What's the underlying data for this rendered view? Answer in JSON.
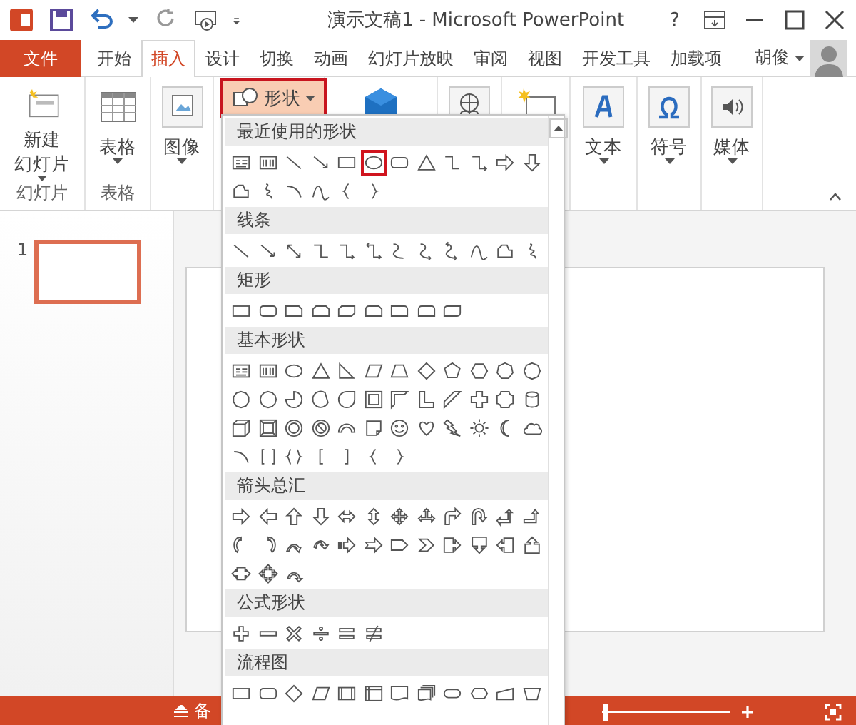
{
  "title_bar": {
    "title": "演示文稿1 - Microsoft PowerPoint",
    "help": "?"
  },
  "tabs": [
    {
      "label": "文件",
      "kind": "file",
      "selected": false
    },
    {
      "label": "开始",
      "kind": "tab",
      "selected": false
    },
    {
      "label": "插入",
      "kind": "tab",
      "selected": true
    },
    {
      "label": "设计",
      "kind": "tab",
      "selected": false
    },
    {
      "label": "切换",
      "kind": "tab",
      "selected": false
    },
    {
      "label": "动画",
      "kind": "tab",
      "selected": false
    },
    {
      "label": "幻灯片放映",
      "kind": "tab",
      "selected": false
    },
    {
      "label": "审阅",
      "kind": "tab",
      "selected": false
    },
    {
      "label": "视图",
      "kind": "tab",
      "selected": false
    },
    {
      "label": "开发工具",
      "kind": "tab",
      "selected": false
    },
    {
      "label": "加载项",
      "kind": "tab",
      "selected": false
    }
  ],
  "account": {
    "name": "胡俊"
  },
  "ribbon": [
    {
      "kind": "new-slide",
      "lines": [
        "新建",
        "幻灯片"
      ],
      "group": "幻灯片"
    },
    {
      "kind": "table",
      "label": "表格",
      "group": "表格"
    },
    {
      "kind": "image",
      "label": "图像"
    },
    {
      "kind": "shapes",
      "label": "形状",
      "expanded": true
    },
    {
      "kind": "smartart"
    },
    {
      "kind": "link"
    },
    {
      "kind": "comment"
    },
    {
      "kind": "text",
      "label": "文本"
    },
    {
      "kind": "symbol",
      "label": "符号"
    },
    {
      "kind": "media",
      "label": "媒体"
    }
  ],
  "shapes_menu": [
    {
      "title": "最近使用的形状",
      "items": [
        {
          "kind": "text-box",
          "selected": false
        },
        {
          "kind": "vertical-text-box",
          "selected": false
        },
        {
          "kind": "line",
          "selected": false
        },
        {
          "kind": "arrow-line",
          "selected": false
        },
        {
          "kind": "rectangle",
          "selected": false
        },
        {
          "kind": "ellipse",
          "selected": true
        },
        {
          "kind": "rounded-rectangle",
          "selected": false
        },
        {
          "kind": "triangle",
          "selected": false
        },
        {
          "kind": "elbow-connector",
          "selected": false
        },
        {
          "kind": "elbow-arrow",
          "selected": false
        },
        {
          "kind": "right-arrow",
          "selected": false
        },
        {
          "kind": "down-arrow",
          "selected": false
        },
        {
          "kind": "freeform",
          "selected": false
        },
        {
          "kind": "scribble",
          "selected": false
        },
        {
          "kind": "arc",
          "selected": false
        },
        {
          "kind": "curve",
          "selected": false
        },
        {
          "kind": "left-brace",
          "selected": false
        },
        {
          "kind": "right-brace",
          "selected": false
        }
      ]
    },
    {
      "title": "线条",
      "items": [
        {
          "kind": "line",
          "selected": false
        },
        {
          "kind": "arrow-line",
          "selected": false
        },
        {
          "kind": "double-arrow-line",
          "selected": false
        },
        {
          "kind": "elbow-connector",
          "selected": false
        },
        {
          "kind": "elbow-arrow",
          "selected": false
        },
        {
          "kind": "elbow-double-arrow",
          "selected": false
        },
        {
          "kind": "curved-connector",
          "selected": false
        },
        {
          "kind": "curved-arrow",
          "selected": false
        },
        {
          "kind": "curved-double-arrow",
          "selected": false
        },
        {
          "kind": "curve",
          "selected": false
        },
        {
          "kind": "freeform",
          "selected": false
        },
        {
          "kind": "scribble",
          "selected": false
        }
      ]
    },
    {
      "title": "矩形",
      "items": [
        {
          "kind": "rectangle",
          "selected": false
        },
        {
          "kind": "rounded-rectangle",
          "selected": false
        },
        {
          "kind": "snip-rectangle",
          "selected": false
        },
        {
          "kind": "snip-two-corners",
          "selected": false
        },
        {
          "kind": "snip-diagonal",
          "selected": false
        },
        {
          "kind": "snip-round",
          "selected": false
        },
        {
          "kind": "round-one-corner",
          "selected": false
        },
        {
          "kind": "round-two-corners",
          "selected": false
        },
        {
          "kind": "round-diagonal",
          "selected": false
        }
      ]
    },
    {
      "title": "基本形状",
      "items": [
        {
          "kind": "text-box",
          "selected": false
        },
        {
          "kind": "vertical-text-box",
          "selected": false
        },
        {
          "kind": "ellipse",
          "selected": false
        },
        {
          "kind": "triangle",
          "selected": false
        },
        {
          "kind": "right-triangle",
          "selected": false
        },
        {
          "kind": "parallelogram",
          "selected": false
        },
        {
          "kind": "trapezoid",
          "selected": false
        },
        {
          "kind": "diamond",
          "selected": false
        },
        {
          "kind": "pentagon",
          "selected": false
        },
        {
          "kind": "hexagon",
          "selected": false
        },
        {
          "kind": "heptagon",
          "selected": false
        },
        {
          "kind": "octagon",
          "selected": false
        },
        {
          "kind": "decagon",
          "selected": false
        },
        {
          "kind": "dodecagon",
          "selected": false
        },
        {
          "kind": "pie",
          "selected": false
        },
        {
          "kind": "chord",
          "selected": false
        },
        {
          "kind": "teardrop",
          "selected": false
        },
        {
          "kind": "frame",
          "selected": false
        },
        {
          "kind": "half-frame",
          "selected": false
        },
        {
          "kind": "l-shape",
          "selected": false
        },
        {
          "kind": "diagonal-stripe",
          "selected": false
        },
        {
          "kind": "cross",
          "selected": false
        },
        {
          "kind": "plaque",
          "selected": false
        },
        {
          "kind": "can",
          "selected": false
        },
        {
          "kind": "cube",
          "selected": false
        },
        {
          "kind": "bevel",
          "selected": false
        },
        {
          "kind": "donut",
          "selected": false
        },
        {
          "kind": "no-symbol",
          "selected": false
        },
        {
          "kind": "block-arc",
          "selected": false
        },
        {
          "kind": "folded-corner",
          "selected": false
        },
        {
          "kind": "smiley",
          "selected": false
        },
        {
          "kind": "heart",
          "selected": false
        },
        {
          "kind": "lightning",
          "selected": false
        },
        {
          "kind": "sun",
          "selected": false
        },
        {
          "kind": "moon",
          "selected": false
        },
        {
          "kind": "cloud",
          "selected": false
        },
        {
          "kind": "arc",
          "selected": false
        },
        {
          "kind": "bracket-pair",
          "selected": false
        },
        {
          "kind": "brace-pair",
          "selected": false
        },
        {
          "kind": "left-bracket",
          "selected": false
        },
        {
          "kind": "right-bracket",
          "selected": false
        },
        {
          "kind": "left-brace",
          "selected": false
        },
        {
          "kind": "right-brace",
          "selected": false
        }
      ]
    },
    {
      "title": "箭头总汇",
      "items": [
        {
          "kind": "right-arrow",
          "selected": false
        },
        {
          "kind": "left-arrow",
          "selected": false
        },
        {
          "kind": "up-arrow",
          "selected": false
        },
        {
          "kind": "down-arrow",
          "selected": false
        },
        {
          "kind": "left-right-arrow",
          "selected": false
        },
        {
          "kind": "up-down-arrow",
          "selected": false
        },
        {
          "kind": "quad-arrow",
          "selected": false
        },
        {
          "kind": "left-right-up-arrow",
          "selected": false
        },
        {
          "kind": "bent-arrow",
          "selected": false
        },
        {
          "kind": "u-turn-arrow",
          "selected": false
        },
        {
          "kind": "left-up-arrow",
          "selected": false
        },
        {
          "kind": "bent-up-arrow",
          "selected": false
        },
        {
          "kind": "curved-right-arrow",
          "selected": false
        },
        {
          "kind": "curved-left-arrow",
          "selected": false
        },
        {
          "kind": "curved-up-arrow",
          "selected": false
        },
        {
          "kind": "curved-down-arrow",
          "selected": false
        },
        {
          "kind": "striped-right-arrow",
          "selected": false
        },
        {
          "kind": "notched-right-arrow",
          "selected": false
        },
        {
          "kind": "pentagon-arrow",
          "selected": false
        },
        {
          "kind": "chevron",
          "selected": false
        },
        {
          "kind": "right-arrow-callout",
          "selected": false
        },
        {
          "kind": "down-arrow-callout",
          "selected": false
        },
        {
          "kind": "left-arrow-callout",
          "selected": false
        },
        {
          "kind": "up-arrow-callout",
          "selected": false
        },
        {
          "kind": "left-right-arrow-callout",
          "selected": false
        },
        {
          "kind": "quad-arrow-callout",
          "selected": false
        },
        {
          "kind": "circular-arrow",
          "selected": false
        }
      ]
    },
    {
      "title": "公式形状",
      "items": [
        {
          "kind": "plus",
          "selected": false
        },
        {
          "kind": "minus",
          "selected": false
        },
        {
          "kind": "multiply",
          "selected": false
        },
        {
          "kind": "divide",
          "selected": false
        },
        {
          "kind": "equal",
          "selected": false
        },
        {
          "kind": "not-equal",
          "selected": false
        }
      ]
    },
    {
      "title": "流程图",
      "items": [
        {
          "kind": "rectangle",
          "selected": false
        },
        {
          "kind": "rounded-rectangle",
          "selected": false
        },
        {
          "kind": "diamond",
          "selected": false
        },
        {
          "kind": "parallelogram",
          "selected": false
        },
        {
          "kind": "predefined-process",
          "selected": false
        },
        {
          "kind": "internal-storage",
          "selected": false
        },
        {
          "kind": "document",
          "selected": false
        },
        {
          "kind": "multidocument",
          "selected": false
        },
        {
          "kind": "terminator",
          "selected": false
        },
        {
          "kind": "preparation",
          "selected": false
        },
        {
          "kind": "manual-input",
          "selected": false
        },
        {
          "kind": "manual-operation",
          "selected": false
        }
      ]
    }
  ],
  "slides": [
    {
      "number": "1",
      "selected": true
    }
  ],
  "status_bar": {
    "notes": "备",
    "zoom": {
      "level": 0.02
    }
  }
}
